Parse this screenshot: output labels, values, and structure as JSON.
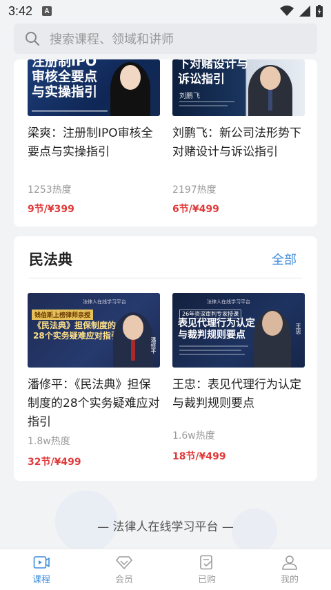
{
  "status": {
    "time": "3:42",
    "notif_letter": "A"
  },
  "search": {
    "placeholder": "搜索课程、领域和讲师"
  },
  "top_courses": [
    {
      "thumb_lines": [
        "注册制IPO",
        "审核全要点",
        "与实操指引"
      ],
      "title": "梁爽：注册制IPO审核全要点与实操指引",
      "heat": "1253热度",
      "price": "9节/¥399"
    },
    {
      "thumb_lines": [
        "下对赌设计与",
        "诉讼指引"
      ],
      "thumb_name": "刘鹏飞",
      "title": "刘鹏飞：新公司法形势下对赌设计与诉讼指引",
      "heat": "2197热度",
      "price": "6节/¥499"
    }
  ],
  "section": {
    "title": "民法典",
    "more": "全部",
    "courses": [
      {
        "thumb_top": "钱伯斯上榜律师亲授",
        "thumb_brand": "法律人在线学习平台",
        "thumb_lines": [
          "《民法典》担保制度的",
          "28个实务疑难应对指引"
        ],
        "thumb_name": "潘修平",
        "title": "潘修平：《民法典》担保制度的28个实务疑难应对指引",
        "heat": "1.8w热度",
        "price": "32节/¥499"
      },
      {
        "thumb_top": "26年资深审判专家授课",
        "thumb_brand": "法律人在线学习平台",
        "thumb_lines": [
          "表见代理行为认定",
          "与裁判规则要点"
        ],
        "thumb_name": "王忠",
        "title": "王忠：表见代理行为认定与裁判规则要点",
        "heat": "1.6w热度",
        "price": "18节/¥499"
      }
    ]
  },
  "footer": {
    "slogan": "— 法律人在线学习平台 —"
  },
  "tabs": [
    {
      "label": "课程",
      "icon": "play-video-icon",
      "active": true
    },
    {
      "label": "会员",
      "icon": "diamond-icon",
      "active": false
    },
    {
      "label": "已购",
      "icon": "purchased-doc-icon",
      "active": false
    },
    {
      "label": "我的",
      "icon": "person-icon",
      "active": false
    }
  ],
  "colors": {
    "accent": "#3f8cdc",
    "price": "#e03a3a",
    "background": "#f2f3f5"
  }
}
